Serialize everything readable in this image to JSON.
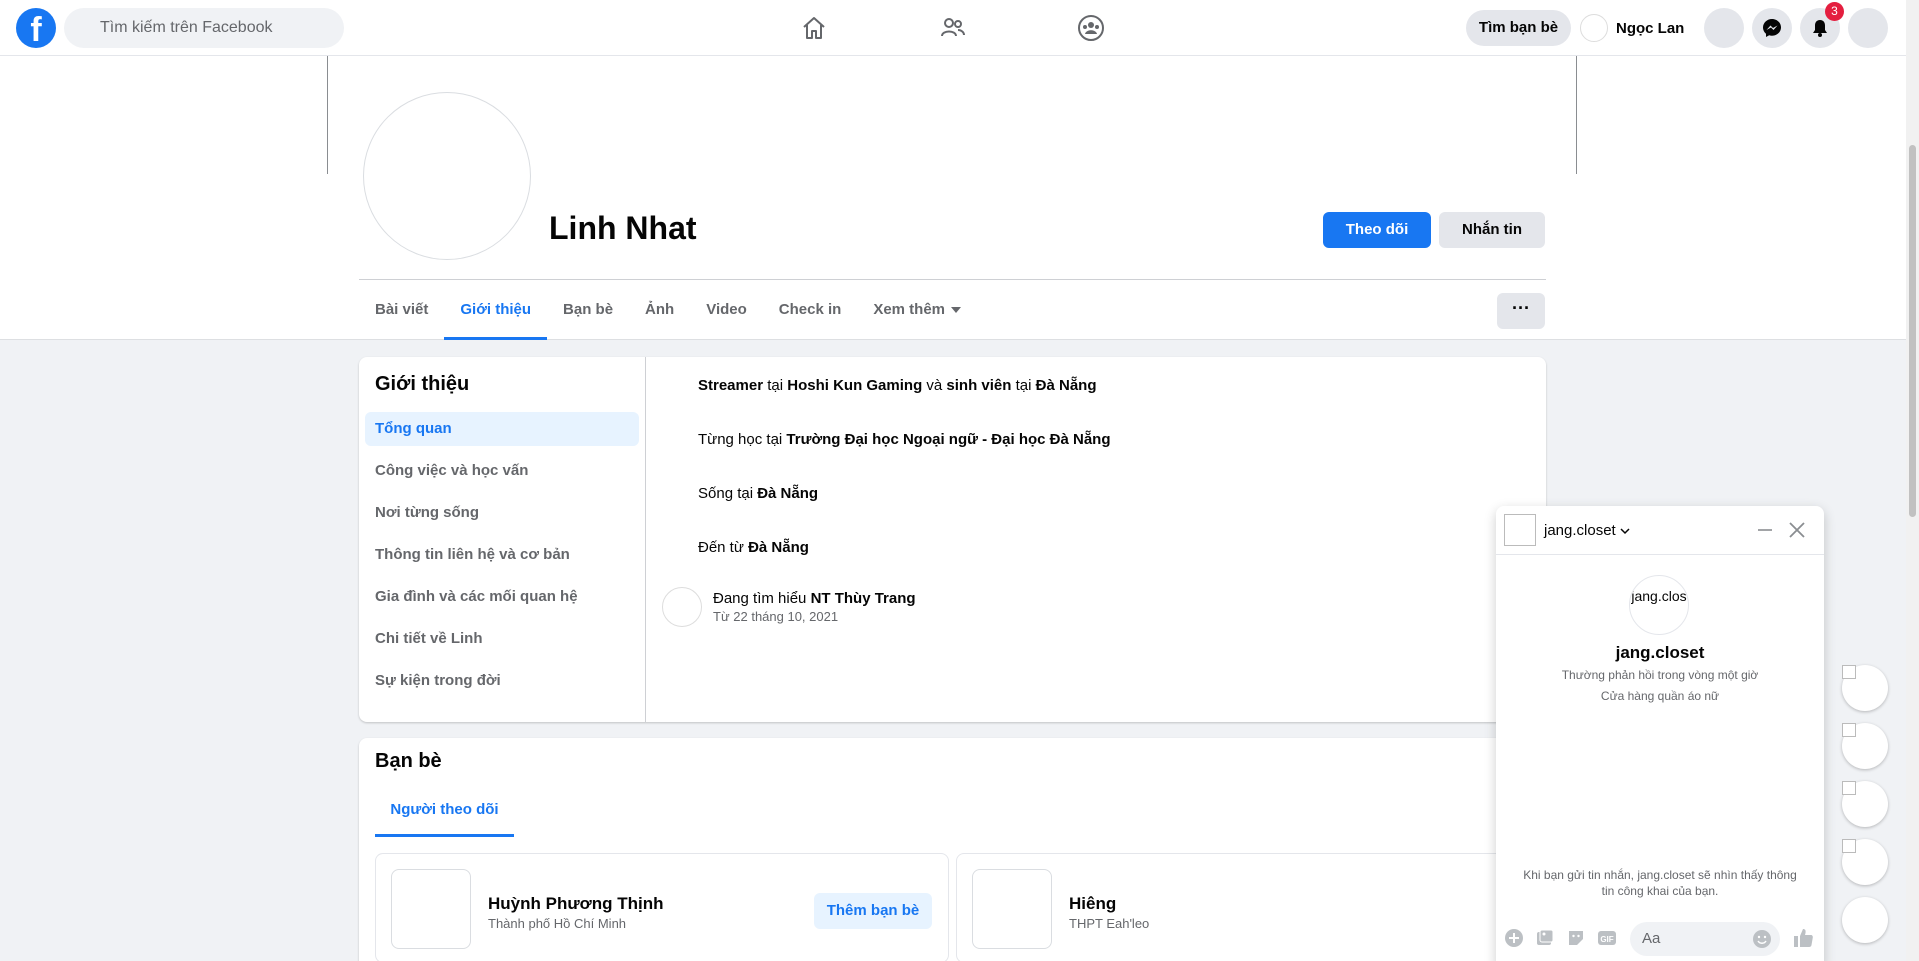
{
  "topbar": {
    "logo": "f",
    "search_placeholder": "Tìm kiếm trên Facebook",
    "find_friends": "Tìm bạn bè",
    "user_name": "Ngọc Lan",
    "notification_count": "3"
  },
  "profile": {
    "name": "Linh Nhat",
    "follow": "Theo dõi",
    "message": "Nhắn tin",
    "more": "···",
    "tabs": [
      "Bài viết",
      "Giới thiệu",
      "Bạn bè",
      "Ảnh",
      "Video",
      "Check in",
      "Xem thêm"
    ]
  },
  "about": {
    "title": "Giới thiệu",
    "menu": [
      "Tổng quan",
      "Công việc và học vấn",
      "Nơi từng sống",
      "Thông tin liên hệ và cơ bản",
      "Gia đình và các mối quan hệ",
      "Chi tiết về Linh",
      "Sự kiện trong đời"
    ],
    "work": {
      "a": "Streamer",
      "t1": " tại ",
      "b": "Hoshi Kun Gaming",
      "t2": " và ",
      "c": "sinh viên",
      "t3": " tại ",
      "d": "Đà Nẵng"
    },
    "school": {
      "t1": "Từng học tại ",
      "a": "Trường Đại học Ngoại ngữ - Đại học Đà Nẵng"
    },
    "lives": {
      "t1": "Sống tại ",
      "a": "Đà Nẵng"
    },
    "from": {
      "t1": "Đến từ ",
      "a": "Đà Nẵng"
    },
    "relationship": {
      "t1": "Đang tìm hiểu ",
      "a": "NT Thùy Trang",
      "since": "Từ 22 tháng 10, 2021"
    }
  },
  "friends": {
    "title": "Bạn bè",
    "tab": "Người theo dõi",
    "items": [
      {
        "name": "Huỳnh Phương Thịnh",
        "sub": "Thành phố Hồ Chí Minh",
        "action": "Thêm bạn bè"
      },
      {
        "name": "Hiêng",
        "sub": "THPT Eah'leo"
      }
    ]
  },
  "chat": {
    "name": "jang.closet",
    "avatar_alt": "jang.clos",
    "title": "jang.closet",
    "response": "Thường phản hồi trong vòng một giờ",
    "category": "Cửa hàng quần áo nữ",
    "note": "Khi bạn gửi tin nhắn, jang.closet sẽ nhìn thấy thông tin công khai của bạn.",
    "input_placeholder": "Aa"
  },
  "colors": {
    "brand": "#1877f2",
    "badge": "#e41e3f"
  }
}
